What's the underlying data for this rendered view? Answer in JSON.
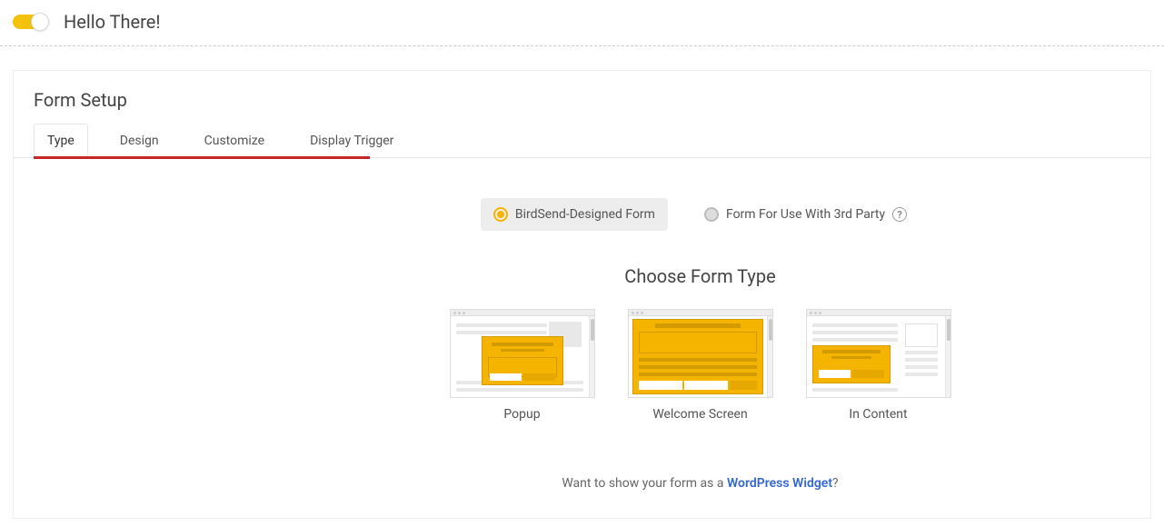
{
  "header": {
    "title": "Hello There!",
    "toggle_on": true
  },
  "panel": {
    "title": "Form Setup"
  },
  "tabs": [
    {
      "id": "type",
      "label": "Type",
      "active": true
    },
    {
      "id": "design",
      "label": "Design",
      "active": false
    },
    {
      "id": "customize",
      "label": "Customize",
      "active": false
    },
    {
      "id": "display-trigger",
      "label": "Display Trigger",
      "active": false
    }
  ],
  "form_source": {
    "options": [
      {
        "id": "birdsend",
        "label": "BirdSend-Designed Form",
        "selected": true
      },
      {
        "id": "thirdparty",
        "label": "Form For Use With 3rd Party",
        "selected": false,
        "help": true
      }
    ]
  },
  "choose_heading": "Choose Form Type",
  "form_types": [
    {
      "id": "popup",
      "label": "Popup"
    },
    {
      "id": "welcome",
      "label": "Welcome Screen"
    },
    {
      "id": "incontent",
      "label": "In Content"
    }
  ],
  "footer": {
    "prefix": "Want to show your form as a ",
    "link": "WordPress Widget",
    "suffix": "?"
  }
}
